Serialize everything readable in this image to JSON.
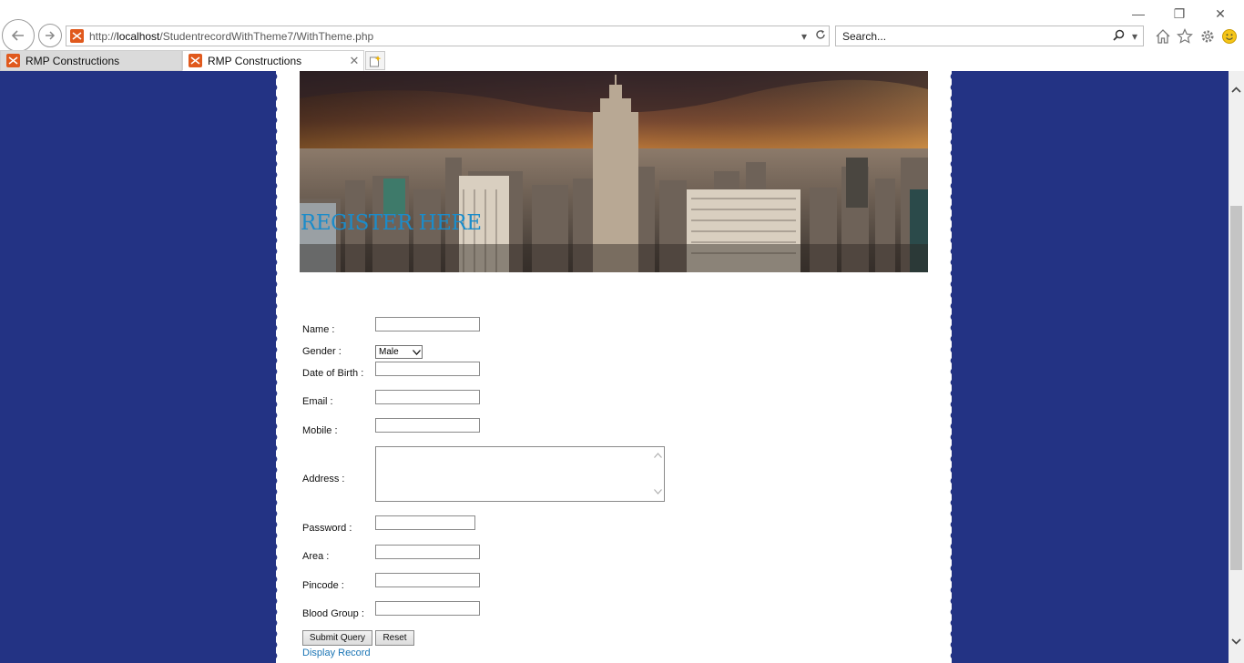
{
  "browser": {
    "url_prefix": "http://",
    "url_host": "localhost",
    "url_path": "/StudentrecordWithTheme7/WithTheme.php",
    "search_placeholder": "Search...",
    "tabs": [
      {
        "label": "RMP Constructions",
        "active": false
      },
      {
        "label": "RMP Constructions",
        "active": true
      }
    ]
  },
  "form": {
    "title": "REGISTER HERE",
    "labels": {
      "name": "Name :",
      "gender": "Gender :",
      "dob": "Date of Birth :",
      "email": "Email :",
      "mobile": "Mobile :",
      "address": "Address :",
      "password": "Password :",
      "area": "Area :",
      "pincode": "Pincode :",
      "blood_group": "Blood Group :"
    },
    "gender_selected": "Male",
    "submit_label": "Submit Query",
    "reset_label": "Reset",
    "display_link": "Display Record"
  },
  "colors": {
    "page_background": "#233384",
    "title_color": "#1b8cca",
    "link_color": "#1b75b5",
    "favicon": "#e0591d"
  }
}
